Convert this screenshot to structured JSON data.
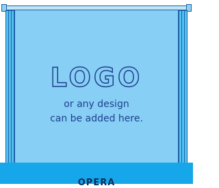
{
  "panel": {
    "logo_text": "LOGO",
    "line_1": "or any design",
    "line_2": "can be added here."
  },
  "base": {
    "label": "OPERA"
  },
  "colors": {
    "panel": "#87cff4",
    "posts": "#4fc2f0",
    "base": "#16a6ea",
    "outline": "#1f5fa6",
    "text": "#1f3f8f"
  }
}
